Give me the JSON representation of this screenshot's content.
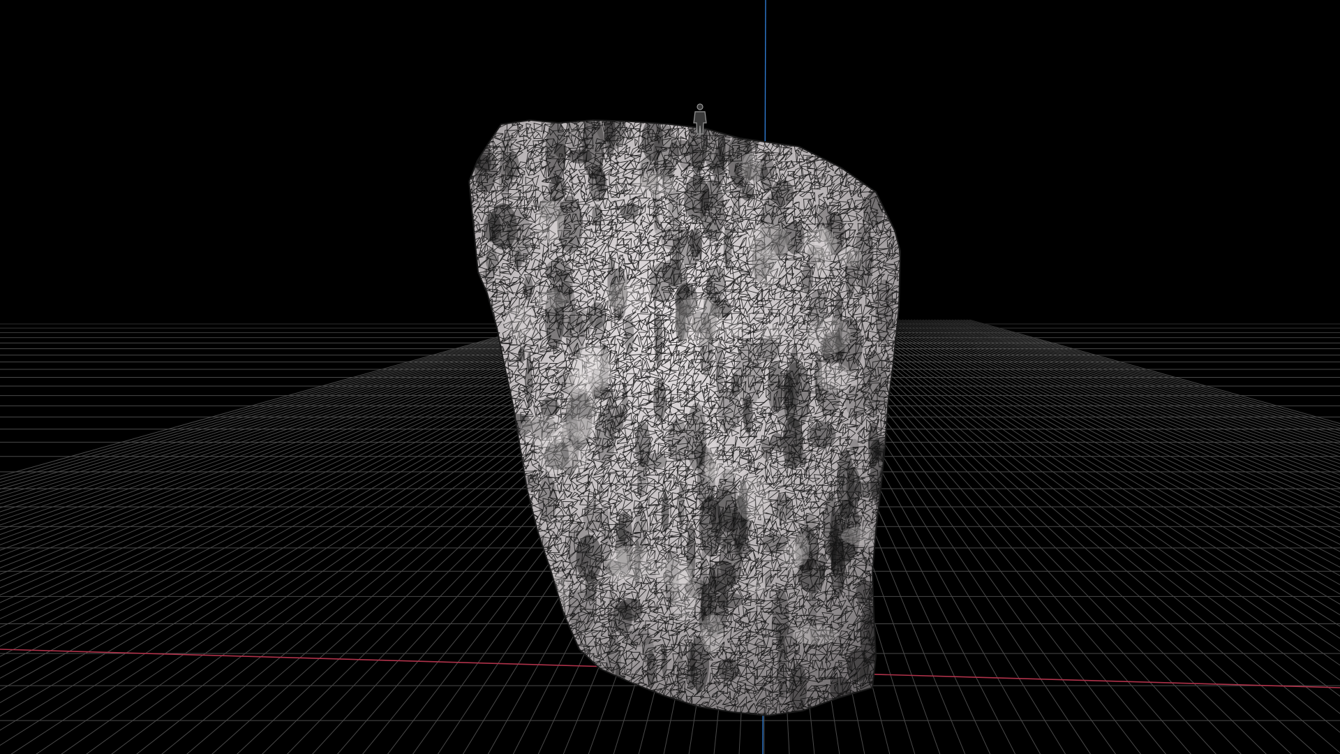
{
  "viewport": {
    "background_color": "#000000",
    "grid_color": "#4a4a4a",
    "x_axis_color": "#b0324a",
    "y_axis_color": "#2f7bd1",
    "mesh_fill_color": "#c9c4c6",
    "mesh_wire_color": "#0a0a0a"
  },
  "scene_objects": [
    {
      "name": "scanned-rock-mesh",
      "display": "wireframe-on-shaded"
    },
    {
      "name": "reference-human-figure",
      "display": "wireframe"
    }
  ],
  "grid": {
    "visible": true,
    "perspective": true
  },
  "axes": {
    "x_visible": true,
    "y_visible": true
  }
}
